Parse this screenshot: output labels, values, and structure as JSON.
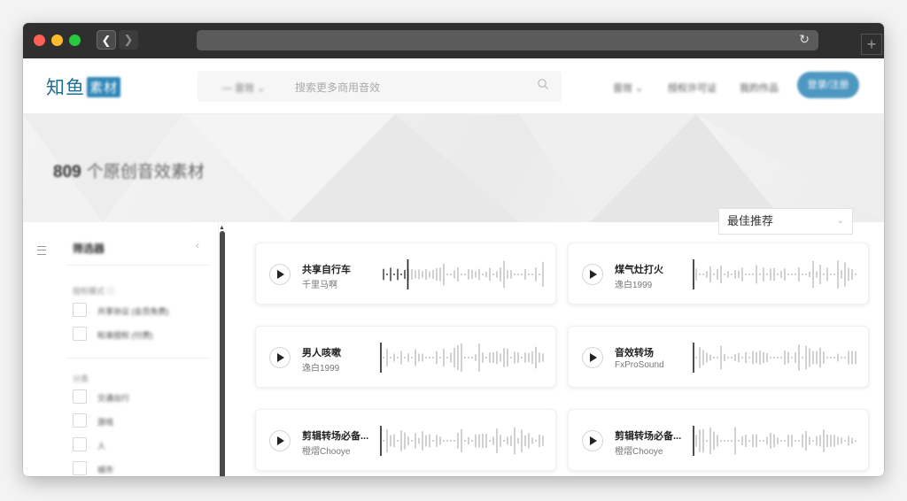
{
  "site": {
    "logo_text": "知鱼",
    "logo_badge": "素材",
    "search_scope": "— 音效 ⌄",
    "search_placeholder": "搜索更多商用音效",
    "nav": [
      "音效 ⌄",
      "授权许可证",
      "我的作品"
    ],
    "cta_label": "登录/注册"
  },
  "hero": {
    "count": "809",
    "title_suffix": "个原创音效素材"
  },
  "sort": {
    "selected": "最佳推荐"
  },
  "filters": {
    "title": "筛选器",
    "groups": [
      {
        "name": "授权模式 ⓘ",
        "options": [
          "共享协议 (会员免费)",
          "标准授权 (付费)"
        ]
      },
      {
        "name": "分类",
        "options": [
          "交通出行",
          "游戏",
          "人",
          "城市"
        ]
      }
    ]
  },
  "tracks": [
    {
      "title": "共享自行车",
      "author": "千里马啊"
    },
    {
      "title": "煤气灶打火",
      "author": "逸白1999"
    },
    {
      "title": "男人咳嗽",
      "author": "逸白1999"
    },
    {
      "title": "音效转场",
      "author": "FxProSound"
    },
    {
      "title": "剪辑转场必备...",
      "author": "橙熠Chooye"
    },
    {
      "title": "剪辑转场必备...",
      "author": "橙熠Chooye"
    }
  ],
  "colors": {
    "accent": "#2f86b7",
    "chrome": "#2f2f2f"
  },
  "icons": {
    "search": "search-icon",
    "play": "play-icon",
    "reload": "reload-icon",
    "chevron": "chevron-down-icon"
  }
}
